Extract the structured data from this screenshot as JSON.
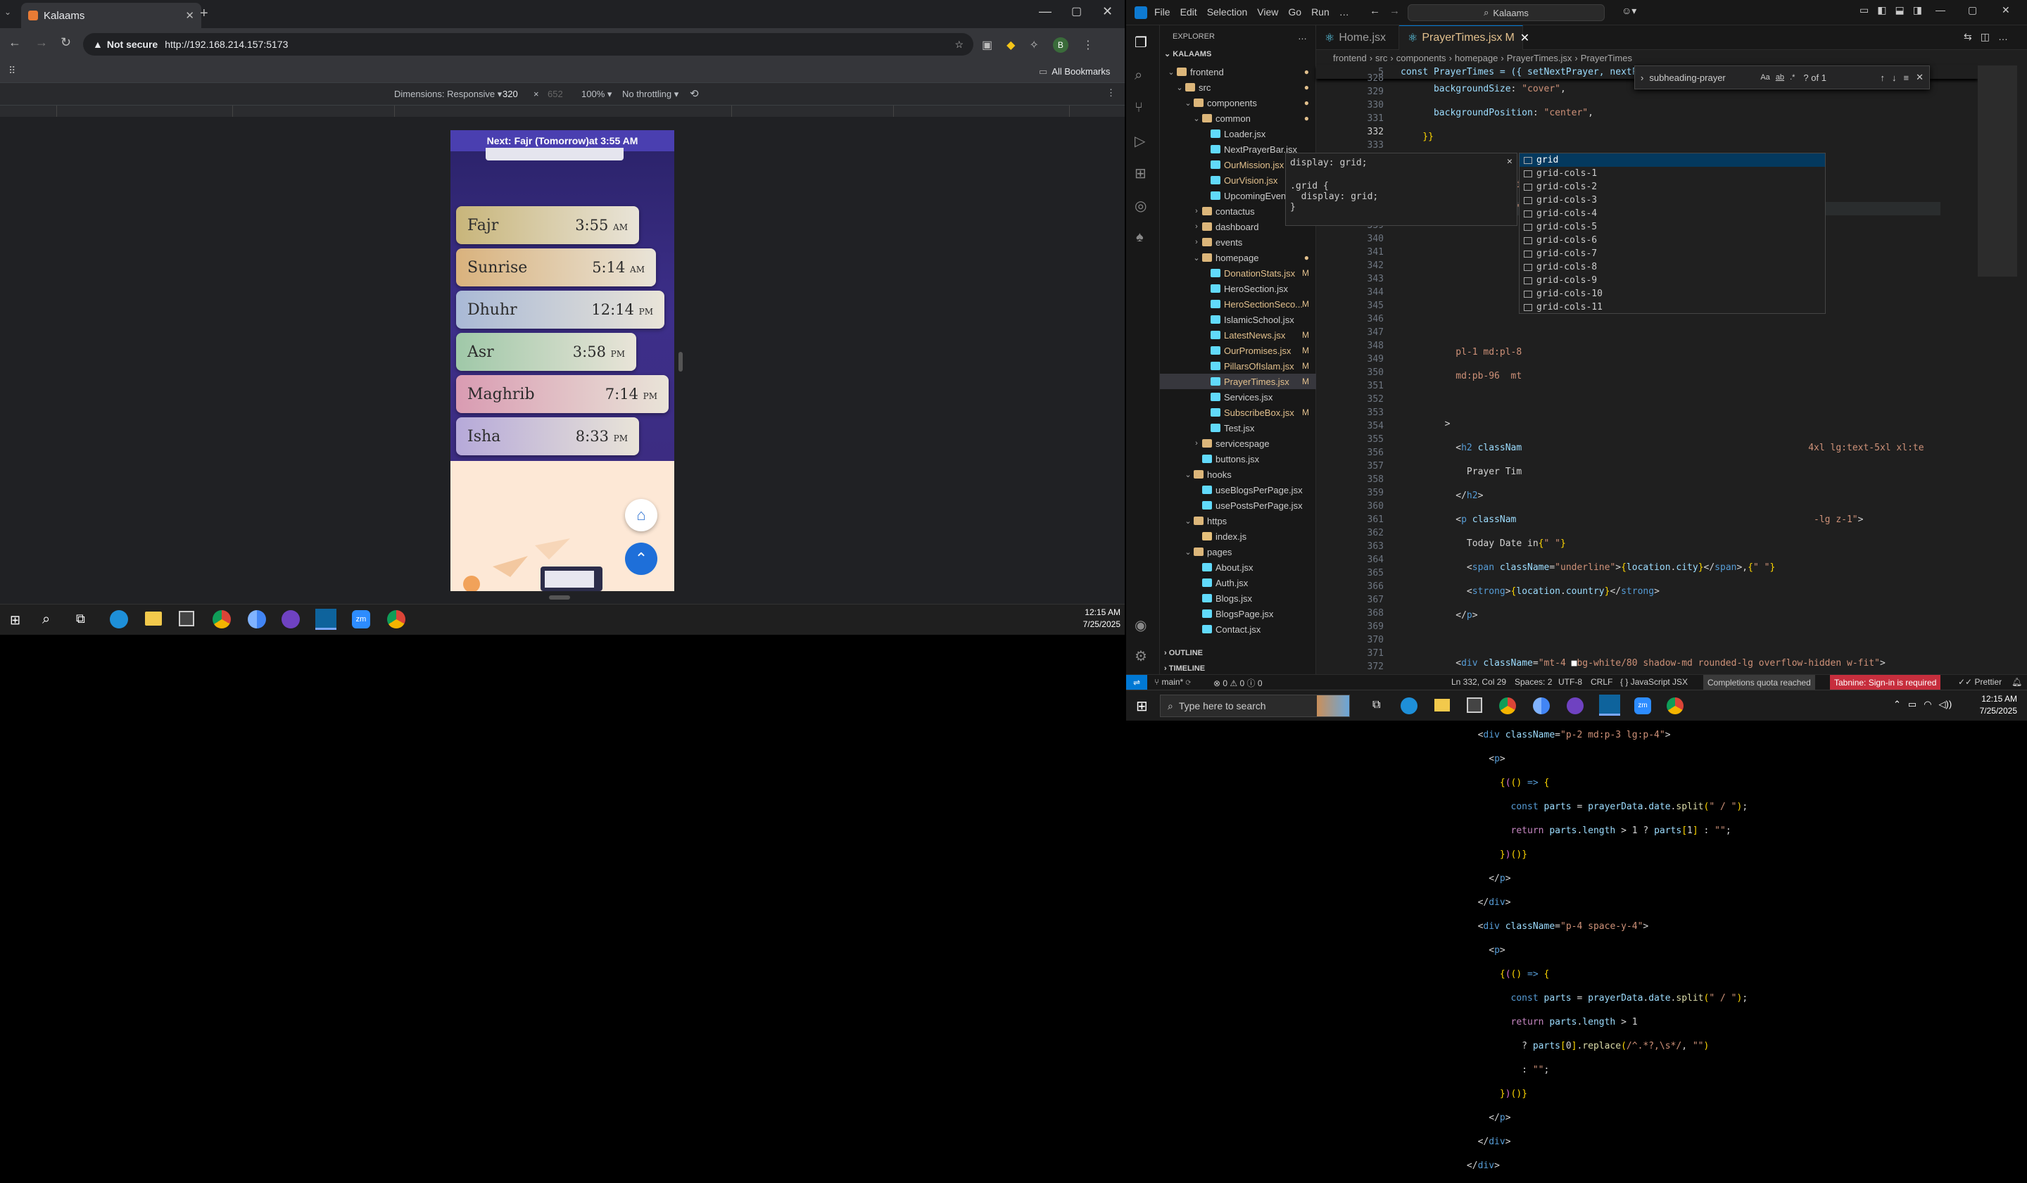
{
  "browser": {
    "tab_title": "Kalaams",
    "not_secure": "Not secure",
    "url": "http://192.168.214.157:5173",
    "all_bookmarks": "All Bookmarks",
    "avatar_letter": "B",
    "devtools": {
      "dimensions_label": "Dimensions: Responsive",
      "width": "320",
      "times": "×",
      "height": "652",
      "zoom": "100%",
      "throttle": "No throttling"
    }
  },
  "app": {
    "next_prayer_banner": {
      "prefix": "Next: ",
      "name": "Fajr (Tomorrow)",
      "suffix": " at 3:55 AM"
    },
    "prayers": [
      {
        "name": "Fajr",
        "time": "3:55",
        "ampm": "AM",
        "color": "#c8b57a"
      },
      {
        "name": "Sunrise",
        "time": "5:14",
        "ampm": "AM",
        "color": "#d9b27d"
      },
      {
        "name": "Dhuhr",
        "time": "12:14",
        "ampm": "PM",
        "color": "#a9b9d6"
      },
      {
        "name": "Asr",
        "time": "3:58",
        "ampm": "PM",
        "color": "#9fc8a8"
      },
      {
        "name": "Maghrib",
        "time": "7:14",
        "ampm": "PM",
        "color": "#d99bb2"
      },
      {
        "name": "Isha",
        "time": "8:33",
        "ampm": "PM",
        "color": "#b6a9d9"
      }
    ]
  },
  "taskbar_left": {
    "time": "12:15 AM",
    "date": "7/25/2025"
  },
  "vscode": {
    "menu": [
      "File",
      "Edit",
      "Selection",
      "View",
      "Go",
      "Run",
      "…"
    ],
    "search": "Kalaams",
    "explorer_title": "EXPLORER",
    "root": "KALAAMS",
    "tree": [
      {
        "label": "frontend",
        "indent": 0,
        "type": "folder-open",
        "status": "dot"
      },
      {
        "label": "src",
        "indent": 1,
        "type": "folder-open",
        "status": "dot"
      },
      {
        "label": "components",
        "indent": 2,
        "type": "folder-open",
        "status": "dot"
      },
      {
        "label": "common",
        "indent": 3,
        "type": "folder-open",
        "status": "dot"
      },
      {
        "label": "Loader.jsx",
        "indent": 4,
        "type": "file",
        "status": ""
      },
      {
        "label": "NextPrayerBar.jsx",
        "indent": 4,
        "type": "file",
        "status": ""
      },
      {
        "label": "OurMission.jsx",
        "indent": 4,
        "type": "file",
        "status": "M"
      },
      {
        "label": "OurVision.jsx",
        "indent": 4,
        "type": "file",
        "status": "M"
      },
      {
        "label": "UpcomingEvents...",
        "indent": 4,
        "type": "file",
        "status": ""
      },
      {
        "label": "contactus",
        "indent": 3,
        "type": "folder",
        "status": ""
      },
      {
        "label": "dashboard",
        "indent": 3,
        "type": "folder",
        "status": ""
      },
      {
        "label": "events",
        "indent": 3,
        "type": "folder",
        "status": ""
      },
      {
        "label": "homepage",
        "indent": 3,
        "type": "folder-open",
        "status": "dot"
      },
      {
        "label": "DonationStats.jsx",
        "indent": 4,
        "type": "file",
        "status": "M"
      },
      {
        "label": "HeroSection.jsx",
        "indent": 4,
        "type": "file",
        "status": ""
      },
      {
        "label": "HeroSectionSeco...",
        "indent": 4,
        "type": "file",
        "status": "M"
      },
      {
        "label": "IslamicSchool.jsx",
        "indent": 4,
        "type": "file",
        "status": ""
      },
      {
        "label": "LatestNews.jsx",
        "indent": 4,
        "type": "file",
        "status": "M"
      },
      {
        "label": "OurPromises.jsx",
        "indent": 4,
        "type": "file",
        "status": "M"
      },
      {
        "label": "PillarsOfIslam.jsx",
        "indent": 4,
        "type": "file",
        "status": "M"
      },
      {
        "label": "PrayerTimes.jsx",
        "indent": 4,
        "type": "file",
        "status": "M",
        "selected": true
      },
      {
        "label": "Services.jsx",
        "indent": 4,
        "type": "file",
        "status": ""
      },
      {
        "label": "SubscribeBox.jsx",
        "indent": 4,
        "type": "file",
        "status": "M"
      },
      {
        "label": "Test.jsx",
        "indent": 4,
        "type": "file",
        "status": ""
      },
      {
        "label": "servicespage",
        "indent": 3,
        "type": "folder",
        "status": ""
      },
      {
        "label": "buttons.jsx",
        "indent": 3,
        "type": "file",
        "status": ""
      },
      {
        "label": "hooks",
        "indent": 2,
        "type": "folder-open",
        "status": ""
      },
      {
        "label": "useBlogsPerPage.jsx",
        "indent": 3,
        "type": "file",
        "status": ""
      },
      {
        "label": "usePostsPerPage.jsx",
        "indent": 3,
        "type": "file",
        "status": ""
      },
      {
        "label": "https",
        "indent": 2,
        "type": "folder-open",
        "status": ""
      },
      {
        "label": "index.js",
        "indent": 3,
        "type": "file",
        "status": ""
      },
      {
        "label": "pages",
        "indent": 2,
        "type": "folder-open",
        "status": ""
      },
      {
        "label": "About.jsx",
        "indent": 3,
        "type": "file",
        "status": ""
      },
      {
        "label": "Auth.jsx",
        "indent": 3,
        "type": "file",
        "status": ""
      },
      {
        "label": "Blogs.jsx",
        "indent": 3,
        "type": "file",
        "status": ""
      },
      {
        "label": "BlogsPage.jsx",
        "indent": 3,
        "type": "file",
        "status": ""
      },
      {
        "label": "Contact.jsx",
        "indent": 3,
        "type": "file",
        "status": ""
      }
    ],
    "outline": "OUTLINE",
    "timeline": "TIMELINE",
    "tabs": [
      {
        "label": "Home.jsx",
        "active": false
      },
      {
        "label": "PrayerTimes.jsx",
        "active": true,
        "modified": "M"
      }
    ],
    "breadcrumbs": [
      "frontend",
      "src",
      "components",
      "homepage",
      "PrayerTimes.jsx",
      "PrayerTimes"
    ],
    "sticky_line_number": "5",
    "sticky_line": "const PrayerTimes = ({ setNextPrayer, nextPrayer",
    "find": {
      "query": "subheading-prayer",
      "opt_case": "Aa",
      "opt_word": "ab",
      "opt_regex": ".*",
      "result": "? of 1"
    },
    "hover": {
      "title": "display: grid;",
      "line1": ".grid {",
      "line2": "  display: grid;",
      "line3": "}"
    },
    "suggestions": [
      "grid",
      "grid-cols-1",
      "grid-cols-2",
      "grid-cols-3",
      "grid-cols-4",
      "grid-cols-5",
      "grid-cols-6",
      "grid-cols-7",
      "grid-cols-8",
      "grid-cols-9",
      "grid-cols-10",
      "grid-cols-11"
    ],
    "status": {
      "branch": "main*",
      "errors": "0",
      "warnings": "0",
      "info": "0",
      "position": "Ln 332, Col 29",
      "spaces": "Spaces: 2",
      "encoding": "UTF-8",
      "eol": "CRLF",
      "language": "JavaScript JSX",
      "quota": "Completions quota reached",
      "tabnine": "Tabnine: Sign-in is required",
      "prettier": "Prettier"
    }
  },
  "taskbar_right": {
    "search_placeholder": "Type here to search",
    "time": "12:15 AM",
    "date": "7/25/2025"
  }
}
